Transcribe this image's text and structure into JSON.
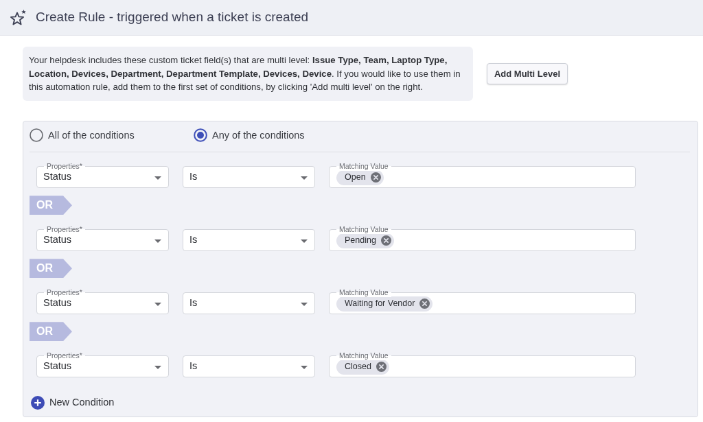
{
  "header": {
    "title": "Create Rule - triggered when a ticket is created"
  },
  "info": {
    "text": "Your helpdesk includes these custom ticket field(s) that are multi level: **Issue Type, Team, Laptop Type, Location, Devices, Department, Department Template, Devices, Device**. If you would like to use them in this automation rule, add them to the first set of conditions, by clicking 'Add multi level' on the right.",
    "button": "Add Multi Level"
  },
  "match_mode": [
    {
      "label": "All of the conditions",
      "selected": false
    },
    {
      "label": "Any of the conditions",
      "selected": true
    }
  ],
  "conditions": [
    {
      "property_label": "Properties*",
      "property": "Status",
      "operator": "Is",
      "value_label": "Matching Value",
      "values": [
        "Open"
      ]
    },
    {
      "joiner": "OR",
      "property_label": "Properties*",
      "property": "Status",
      "operator": "Is",
      "value_label": "Matching Value",
      "values": [
        "Pending"
      ]
    },
    {
      "joiner": "OR",
      "property_label": "Properties*",
      "property": "Status",
      "operator": "Is",
      "value_label": "Matching Value",
      "values": [
        "Waiting for Vendor"
      ]
    },
    {
      "joiner": "OR",
      "property_label": "Properties*",
      "property": "Status",
      "operator": "Is",
      "value_label": "Matching Value",
      "values": [
        "Closed"
      ]
    }
  ],
  "new_condition": "New Condition"
}
